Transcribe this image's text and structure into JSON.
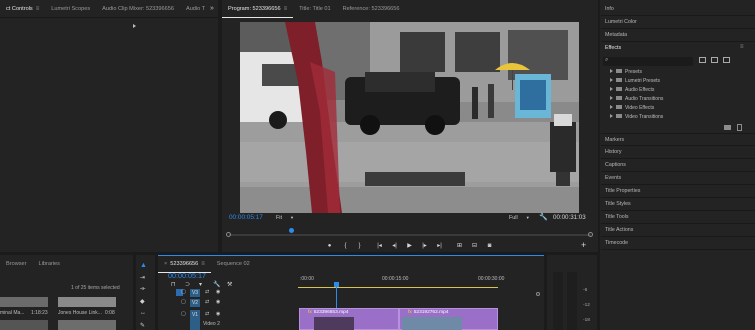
{
  "source_panel": {
    "tabs": [
      "ct Controls",
      "Lumetri Scopes",
      "Audio Clip Mixer: 523396656",
      "Audio T"
    ],
    "overflow": "»"
  },
  "program_monitor": {
    "tabs": [
      "Program: 523396656",
      "Title: Title 01",
      "Reference: 523396656"
    ],
    "timecode_current": "00:00:05:17",
    "fit_label": "Fit",
    "quality_label": "Full",
    "timecode_duration": "00:00:31:03",
    "add_button": "+"
  },
  "right_panel": {
    "info": "Info",
    "lumetri_color": "Lumetri Color",
    "metadata": "Metadata",
    "effects": "Effects",
    "effects_tree": [
      "Presets",
      "Lumetri Presets",
      "Audio Effects",
      "Audio Transitions",
      "Video Effects",
      "Video Transitions"
    ],
    "lower_items": [
      "Markers",
      "History",
      "Captions",
      "Events",
      "Title Properties",
      "Title Styles",
      "Title Tools",
      "Title Actions",
      "Timecode"
    ]
  },
  "project_panel": {
    "tabs": [
      "Browser",
      "Libraries"
    ],
    "items_selected": "1 of 25 items selected",
    "clips": [
      {
        "name": "minal Ma...",
        "duration": "1:18:23"
      },
      {
        "name": "Jones House Link...",
        "duration": "0:08"
      }
    ]
  },
  "timeline": {
    "tabs": [
      "523396656",
      "Sequence 02"
    ],
    "timecode": "00:00:05:17",
    "ruler": [
      ":00:00",
      "00:00:15:00",
      "00:00:30:00"
    ],
    "track_v3": "V3",
    "track_v2": "V2",
    "track_v1": "V1",
    "track_v1_name": "Video 2",
    "clip_a": "523396653.mp4",
    "clip_b": "523192762.mp4"
  },
  "audio_meter": {
    "labels": [
      "-6",
      "-12",
      "-18"
    ]
  },
  "colors": {
    "accent_blue": "#2d8ceb",
    "clip_purple": "#9a6fc8",
    "work_area_yellow": "#d8c44a"
  }
}
